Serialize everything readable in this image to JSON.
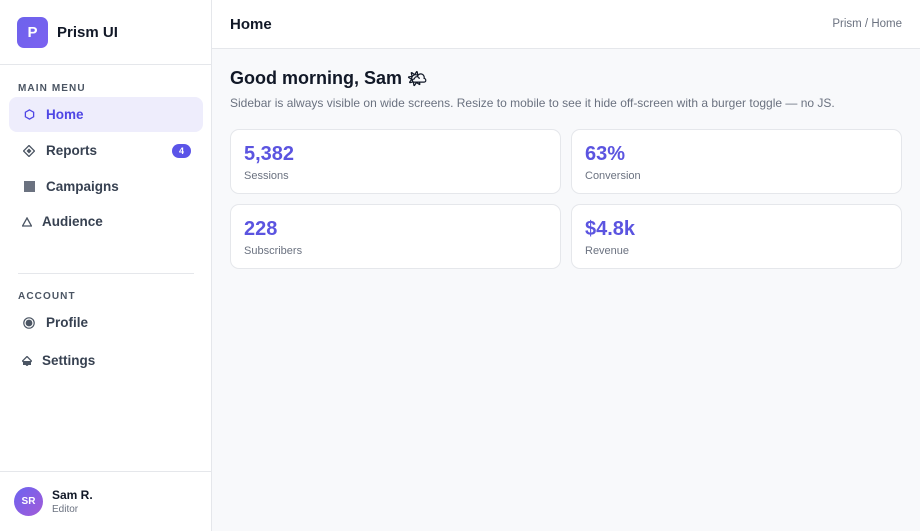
{
  "brand": {
    "logo_letter": "P",
    "name": "Prism UI",
    "accent": "#6d63ec"
  },
  "sidebar": {
    "main_label": "MAIN MENU",
    "main_items": [
      {
        "label": "Home",
        "icon": "hexagon-icon",
        "active": true
      },
      {
        "label": "Reports",
        "icon": "diamond-icon",
        "badge": "4"
      },
      {
        "label": "Campaigns",
        "icon": "square-icon"
      },
      {
        "label": "Audience",
        "icon": "triangle-icon"
      }
    ],
    "account_label": "ACCOUNT",
    "account_items": [
      {
        "label": "Profile",
        "icon": "circle-icon"
      },
      {
        "label": "Settings",
        "icon": "settings-icon"
      }
    ]
  },
  "user": {
    "initials": "SR",
    "name": "Sam R.",
    "role": "Editor"
  },
  "topbar": {
    "title": "Home",
    "breadcrumb": "Prism / Home"
  },
  "main": {
    "greeting": "Good morning, Sam",
    "greeting_emoji": "🌤",
    "subtitle": "Sidebar is always visible on wide screens. Resize to mobile to see it hide off-screen with a burger toggle — no JS.",
    "stats": [
      {
        "value": "5,382",
        "label": "Sessions"
      },
      {
        "value": "63%",
        "label": "Conversion"
      },
      {
        "value": "228",
        "label": "Subscribers"
      },
      {
        "value": "$4.8k",
        "label": "Revenue"
      }
    ]
  }
}
